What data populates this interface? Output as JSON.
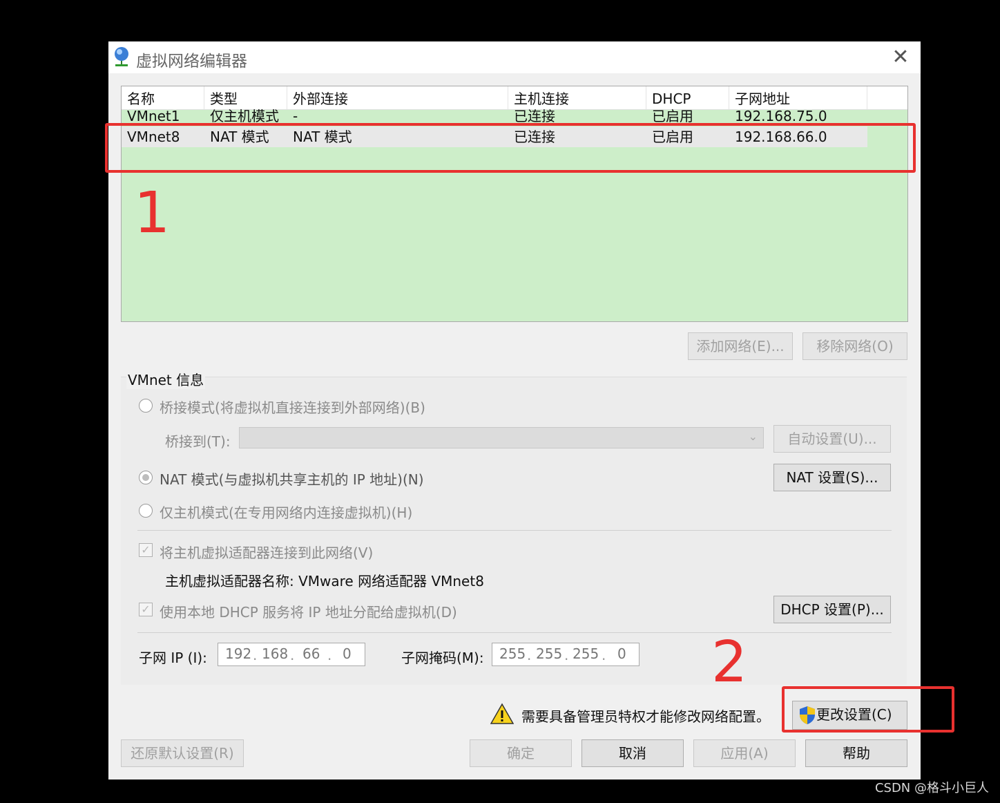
{
  "window": {
    "title": "虚拟网络编辑器",
    "close": "✕"
  },
  "table": {
    "columns": [
      "名称",
      "类型",
      "外部连接",
      "主机连接",
      "DHCP",
      "子网地址"
    ],
    "rows": [
      [
        "VMnet1",
        "仅主机模式",
        "-",
        "已连接",
        "已启用",
        "192.168.75.0"
      ],
      [
        "VMnet8",
        "NAT 模式",
        "NAT 模式",
        "已连接",
        "已启用",
        "192.168.66.0"
      ]
    ]
  },
  "buttons": {
    "add_network": "添加网络(E)...",
    "remove_network": "移除网络(O)",
    "auto_settings": "自动设置(U)...",
    "nat_settings": "NAT 设置(S)...",
    "dhcp_settings": "DHCP 设置(P)...",
    "change_settings": "更改设置(C)",
    "restore_defaults": "还原默认设置(R)",
    "ok": "确定",
    "cancel": "取消",
    "apply": "应用(A)",
    "help": "帮助"
  },
  "vmnet_info": {
    "group_label": "VMnet 信息",
    "bridged_label": "桥接模式(将虚拟机直接连接到外部网络)(B)",
    "bridged_to_label": "桥接到(T):",
    "nat_label": "NAT 模式(与虚拟机共享主机的 IP 地址)(N)",
    "host_only_label": "仅主机模式(在专用网络内连接虚拟机)(H)",
    "selected_mode": "nat",
    "connect_adapter_label": "将主机虚拟适配器连接到此网络(V)",
    "adapter_name_label": "主机虚拟适配器名称: VMware 网络适配器 VMnet8",
    "use_dhcp_label": "使用本地 DHCP 服务将 IP 地址分配给虚拟机(D)",
    "subnet_ip_label": "子网 IP (I):",
    "subnet_ip": [
      "192",
      "168",
      "66",
      "0"
    ],
    "subnet_mask_label": "子网掩码(M):",
    "subnet_mask": [
      "255",
      "255",
      "255",
      "0"
    ]
  },
  "admin_warning": "需要具备管理员特权才能修改网络配置。",
  "annotations": {
    "one": "1",
    "two": "2"
  },
  "watermark": "CSDN @格斗小巨人",
  "colors": {
    "table_bg": "#cdeec9",
    "annotation_red": "#e8312f"
  }
}
